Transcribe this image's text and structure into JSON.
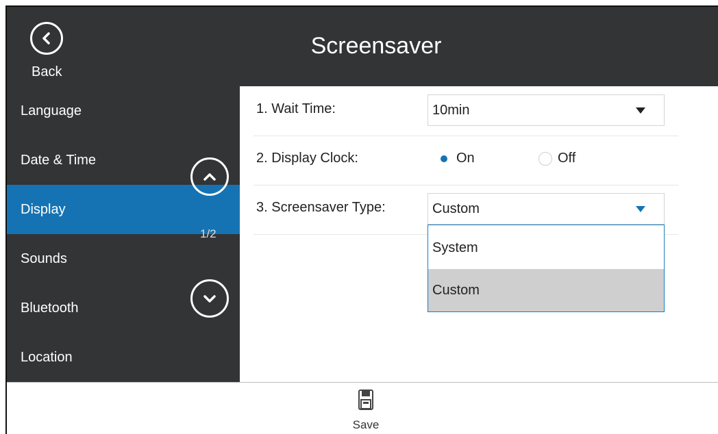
{
  "header": {
    "title": "Screensaver",
    "back_label": "Back"
  },
  "sidebar": {
    "items": [
      {
        "label": "Language",
        "active": false
      },
      {
        "label": "Date & Time",
        "active": false
      },
      {
        "label": "Display",
        "active": true
      },
      {
        "label": "Sounds",
        "active": false
      },
      {
        "label": "Bluetooth",
        "active": false
      },
      {
        "label": "Location",
        "active": false
      }
    ],
    "page_indicator": "1/2"
  },
  "settings": {
    "wait_time": {
      "label": "1. Wait Time:",
      "value": "10min"
    },
    "display_clock": {
      "label": "2. Display Clock:",
      "options": [
        "On",
        "Off"
      ],
      "selected": "On"
    },
    "screensaver_type": {
      "label": "3. Screensaver Type:",
      "value": "Custom",
      "dropdown_open": true,
      "options": [
        "System",
        "Custom"
      ],
      "selected": "Custom"
    }
  },
  "bottombar": {
    "save_label": "Save"
  },
  "colors": {
    "accent": "#1673b3",
    "dark": "#323436",
    "selected_option": "#cfcfcf"
  }
}
